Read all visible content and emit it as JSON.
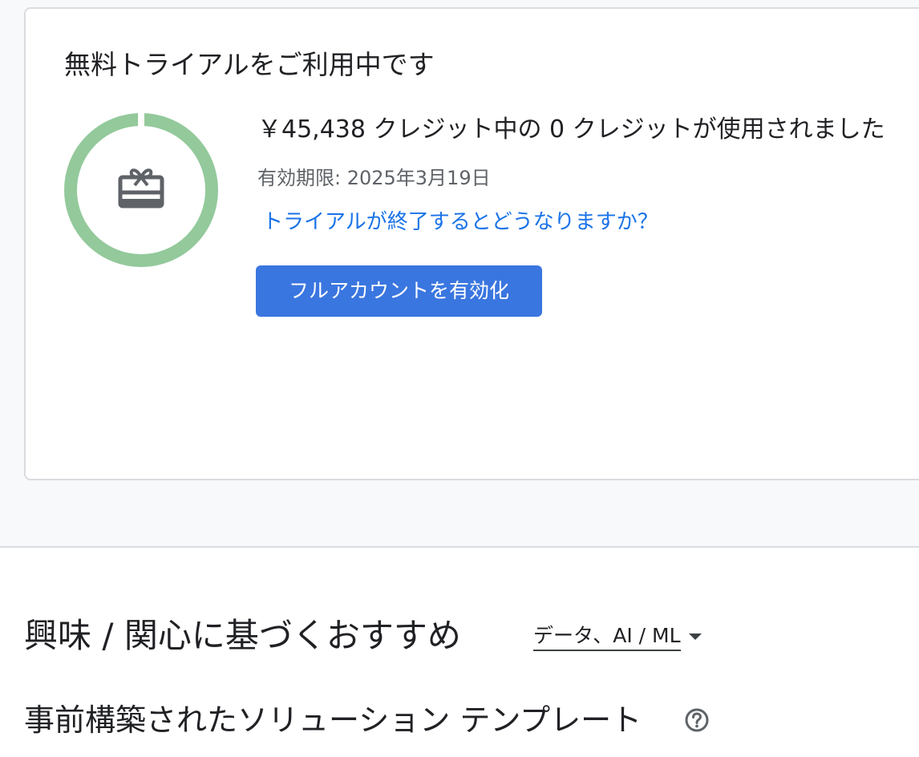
{
  "trial": {
    "title": "無料トライアルをご利用中です",
    "credits_text": "￥45,438 クレジット中の 0 クレジットが使用されました",
    "credits_used_fraction": 0.0,
    "expiry_text": "有効期限: 2025年3月19日",
    "link_text": "トライアルが終了するとどうなりますか？",
    "activate_button_label": "フルアカウントを有効化",
    "ring_color": "#93c99b",
    "ring_gap_color": "#ffffff",
    "icon_color": "#5f6368",
    "icon": "gift-card-icon"
  },
  "recommendations": {
    "heading": "興味 / 関心に基づくおすすめ",
    "dropdown_value": "データ、AI / ML",
    "dropdown_icon": "caret-down-icon"
  },
  "templates": {
    "heading": "事前構築されたソリューション テンプレート",
    "help_icon": "help-circle-icon"
  },
  "colors": {
    "link": "#1a73e8",
    "primary_button": "#3a76e0",
    "page_background": "#f8f9fa"
  }
}
